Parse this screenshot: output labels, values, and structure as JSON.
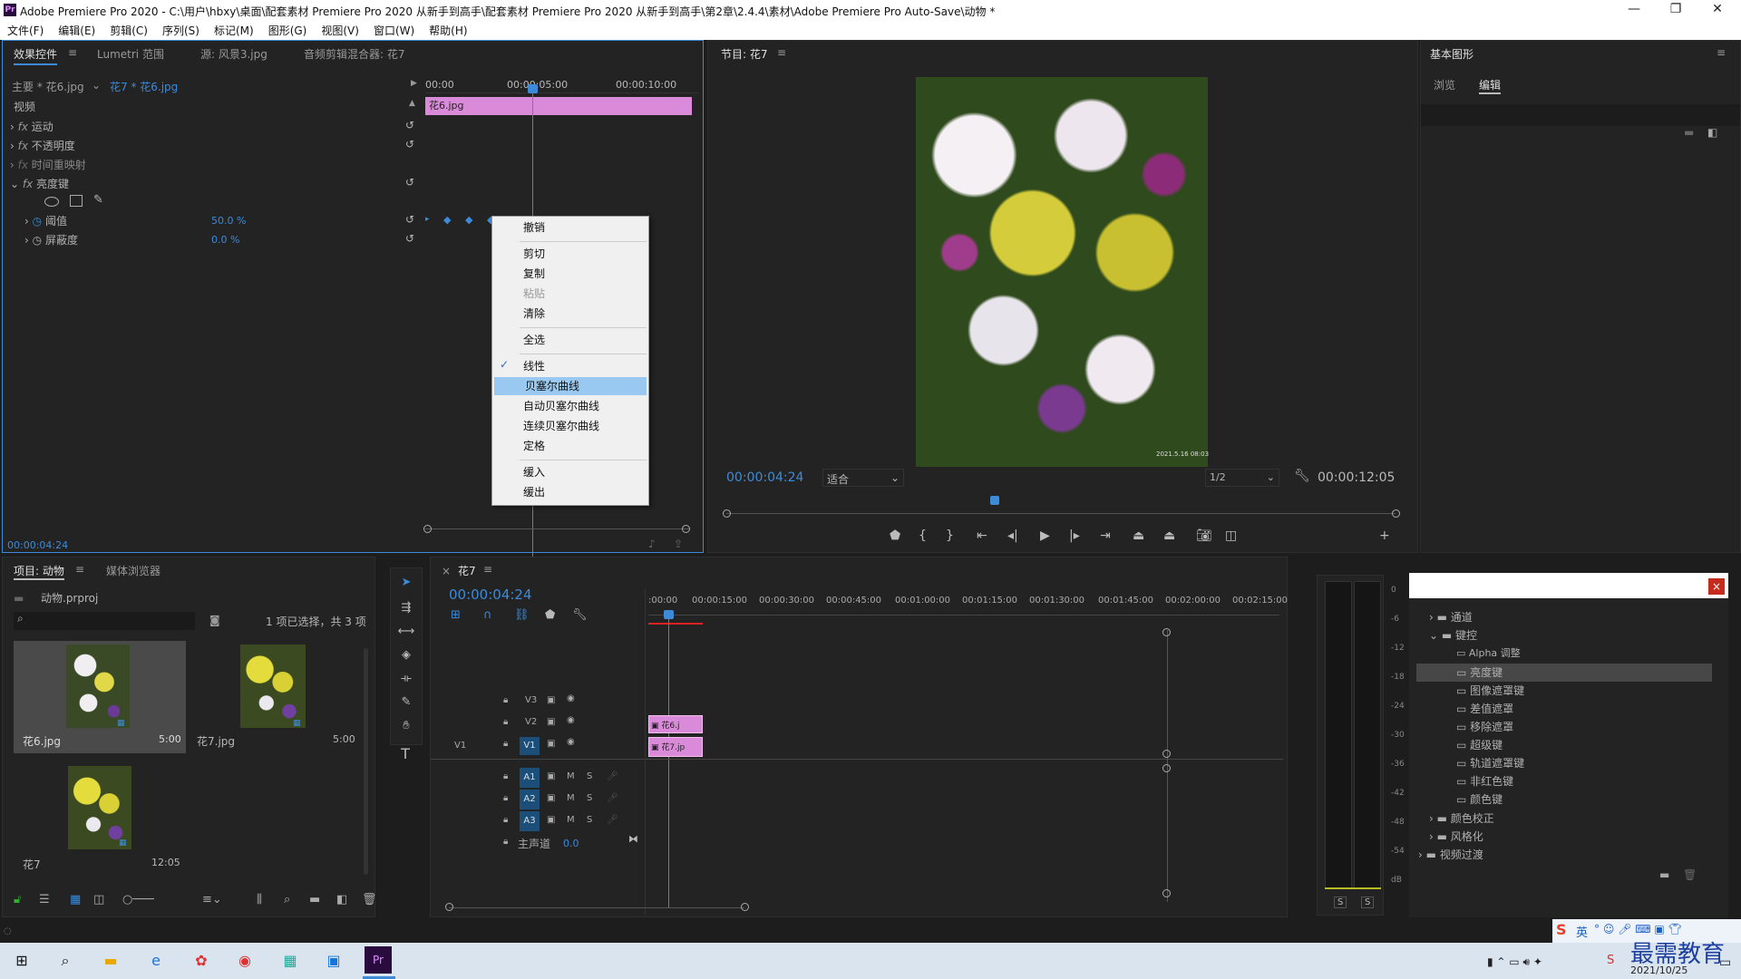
{
  "window": {
    "title": "Adobe Premiere Pro 2020 - C:\\用户\\hbxy\\桌面\\配套素材 Premiere Pro 2020 从新手到高手\\配套素材 Premiere Pro 2020 从新手到高手\\第2章\\2.4.4\\素材\\Adobe Premiere Pro Auto-Save\\动物 *",
    "minimize": "—",
    "restore": "❐",
    "close": "✕",
    "logo": "Pr"
  },
  "menu": [
    "文件(F)",
    "编辑(E)",
    "剪辑(C)",
    "序列(S)",
    "标记(M)",
    "图形(G)",
    "视图(V)",
    "窗口(W)",
    "帮助(H)"
  ],
  "effect_controls": {
    "tabs": [
      "效果控件",
      "Lumetri 范围",
      "源: 风景3.jpg",
      "音频剪辑混合器: 花7"
    ],
    "master": "主要 * 花6.jpg",
    "clip": "花7 * 花6.jpg",
    "ruler": [
      "00:00",
      "00:00:05:00",
      "00:00:10:00"
    ],
    "clip_bar": "花6.jpg",
    "video_header": "视频",
    "effects": [
      "运动",
      "不透明度",
      "时间重映射",
      "亮度键"
    ],
    "fx_label": "fx",
    "params": [
      {
        "name": "阈值",
        "value": "50.0 %"
      },
      {
        "name": "屏蔽度",
        "value": "0.0 %"
      }
    ],
    "timecode": "00:00:04:24"
  },
  "context_menu": {
    "items": [
      "撤销",
      "剪切",
      "复制",
      "粘贴",
      "清除",
      "全选",
      "线性",
      "贝塞尔曲线",
      "自动贝塞尔曲线",
      "连续贝塞尔曲线",
      "定格",
      "缓入",
      "缓出"
    ],
    "checked": "线性",
    "highlighted": "贝塞尔曲线",
    "disabled": "粘贴"
  },
  "program_monitor": {
    "tab": "节目: 花7",
    "timecode": "00:00:04:24",
    "fit": "适合",
    "resolution": "1/2",
    "duration": "00:00:12:05",
    "watermark": "2021.5.16 08:03"
  },
  "essential_graphics": {
    "title": "基本图形",
    "tabs": [
      "浏览",
      "编辑"
    ]
  },
  "project": {
    "tabs": [
      "项目: 动物",
      "媒体浏览器"
    ],
    "file": "动物.prproj",
    "selection": "1 项已选择，共 3 项",
    "items": [
      {
        "name": "花6.jpg",
        "dur": "5:00"
      },
      {
        "name": "花7.jpg",
        "dur": "5:00"
      },
      {
        "name": "花7",
        "dur": "12:05"
      }
    ]
  },
  "timeline": {
    "tab": "花7",
    "timecode": "00:00:04:24",
    "ruler": [
      ":00:00",
      "00:00:15:00",
      "00:00:30:00",
      "00:00:45:00",
      "00:01:00:00",
      "00:01:15:00",
      "00:01:30:00",
      "00:01:45:00",
      "00:02:00:00",
      "00:02:15:00"
    ],
    "video_tracks": [
      "V3",
      "V2",
      "V1"
    ],
    "audio_tracks": [
      "A1",
      "A2",
      "A3"
    ],
    "source_v1": "V1",
    "master": "主声道",
    "master_val": "0.0",
    "clip_v2": "花6.j",
    "clip_v1": "花7.jp",
    "mute": "M",
    "solo": "S"
  },
  "meter": {
    "ticks": [
      "0",
      "-6",
      "-12",
      "-18",
      "-24",
      "-30",
      "-36",
      "-42",
      "-48",
      "-54",
      "dB"
    ],
    "solo": [
      "S",
      "S"
    ]
  },
  "effects_panel": {
    "items": [
      "通道",
      "键控",
      "Alpha 调整",
      "亮度键",
      "图像遮罩键",
      "差值遮罩",
      "移除遮罩",
      "超级键",
      "轨道遮罩键",
      "非红色键",
      "颜色键",
      "颜色校正",
      "风格化",
      "视频过渡"
    ],
    "selected": "亮度键"
  },
  "taskbar": {
    "time": "2021/10/25",
    "brand": "最需教育",
    "ime": "英"
  }
}
